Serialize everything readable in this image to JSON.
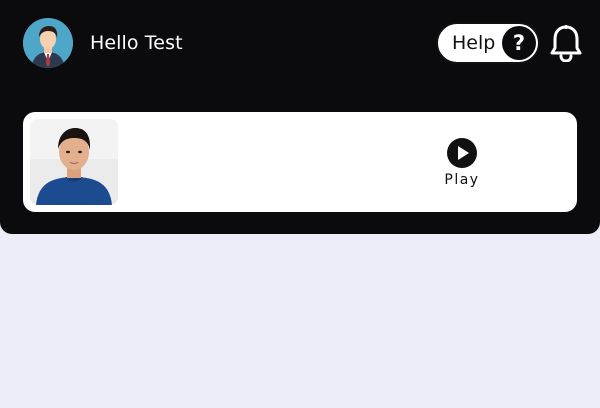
{
  "header": {
    "greeting": "Hello Test",
    "help_label": "Help",
    "help_icon_glyph": "?",
    "avatar_icon": "user-avatar-icon",
    "notification_icon": "bell-icon"
  },
  "video_card": {
    "play_label": "Play",
    "play_icon": "play-circle-icon",
    "thumbnail": "person-video-thumbnail"
  },
  "colors": {
    "header_background": "#0b0a0d",
    "page_background": "#ededf8",
    "card_background": "#ffffff",
    "accent_dark": "#0b0a0d"
  }
}
